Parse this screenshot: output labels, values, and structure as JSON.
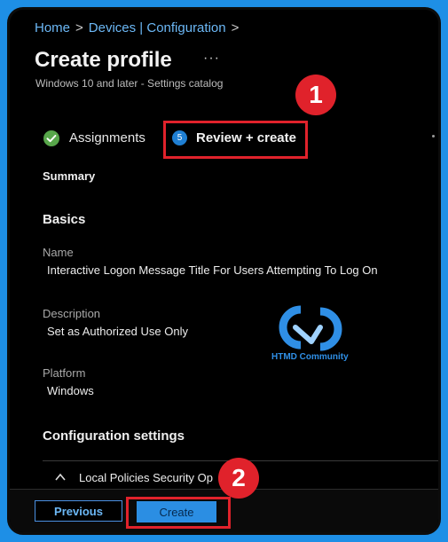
{
  "breadcrumb": {
    "home": "Home",
    "devices": "Devices | Configuration"
  },
  "header": {
    "title": "Create profile",
    "more": "···",
    "subtitle": "Windows 10 and later - Settings catalog"
  },
  "steps": {
    "assignments": "Assignments",
    "review_number": "5",
    "review": "Review + create"
  },
  "callouts": {
    "one": "1",
    "two": "2"
  },
  "summary": {
    "heading": "Summary",
    "basics_heading": "Basics",
    "name_label": "Name",
    "name_value": "Interactive Logon Message Title For Users Attempting To Log On",
    "description_label": "Description",
    "description_value": "Set as Authorized Use Only",
    "platform_label": "Platform",
    "platform_value": "Windows",
    "config_heading": "Configuration settings",
    "local_policies": "Local Policies Security Op"
  },
  "footer": {
    "previous": "Previous",
    "create": "Create"
  },
  "watermark": {
    "text": "HTMD Community"
  },
  "colors": {
    "accent": "#2b8ee3",
    "link": "#6cb8f6",
    "callout": "#e0222b",
    "success": "#57a64a",
    "background": "#1e8fe6"
  }
}
